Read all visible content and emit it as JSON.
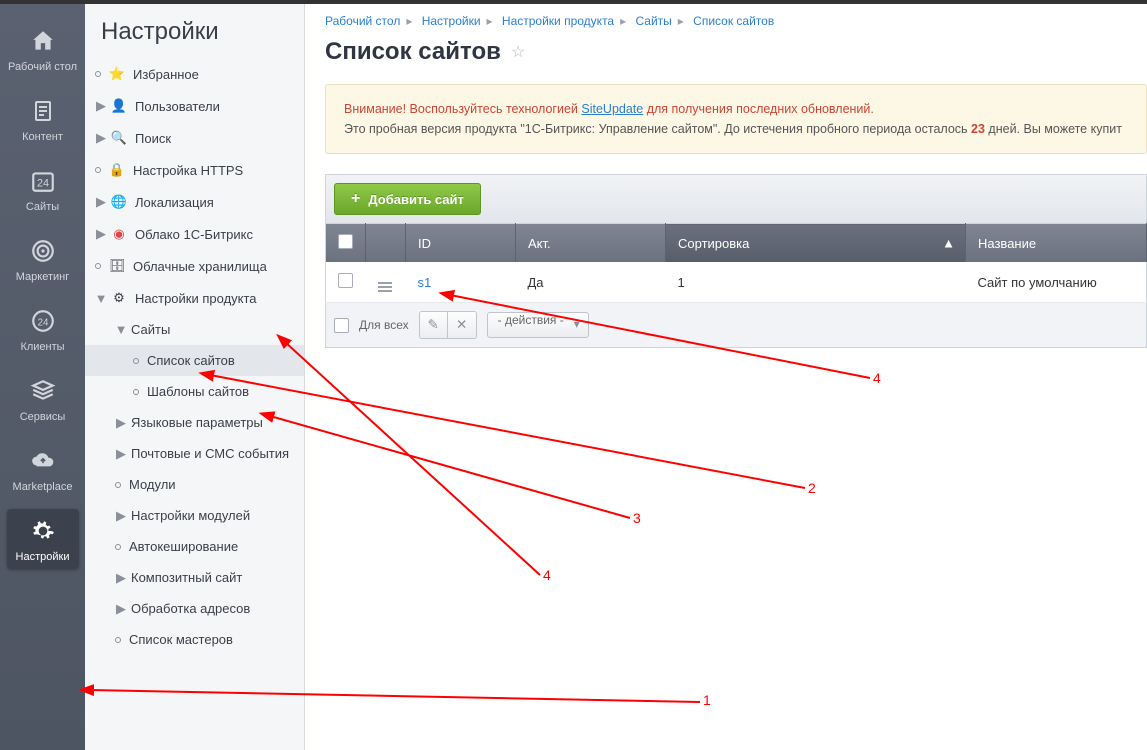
{
  "rail": [
    {
      "key": "desktop",
      "label": "Рабочий стол"
    },
    {
      "key": "content",
      "label": "Контент"
    },
    {
      "key": "sites",
      "label": "Сайты"
    },
    {
      "key": "marketing",
      "label": "Маркетинг"
    },
    {
      "key": "clients",
      "label": "Клиенты"
    },
    {
      "key": "services",
      "label": "Сервисы"
    },
    {
      "key": "marketplace",
      "label": "Marketplace"
    },
    {
      "key": "settings",
      "label": "Настройки"
    }
  ],
  "sidebar": {
    "title": "Настройки",
    "items": {
      "fav": "Избранное",
      "users": "Пользователи",
      "search": "Поиск",
      "https": "Настройка HTTPS",
      "local": "Локализация",
      "cloud1c": "Облако 1С-Битрикс",
      "cloudstor": "Облачные хранилища",
      "product": "Настройки продукта",
      "sites": "Сайты",
      "sitelist": "Список сайтов",
      "sitetpl": "Шаблоны сайтов",
      "langparam": "Языковые параметры",
      "mailsms": "Почтовые и СМС события",
      "modules": "Модули",
      "modset": "Настройки модулей",
      "autocache": "Автокеширование",
      "composite": "Композитный сайт",
      "urlproc": "Обработка адресов",
      "wizards": "Список мастеров"
    }
  },
  "breadcrumb": [
    "Рабочий стол",
    "Настройки",
    "Настройки продукта",
    "Сайты",
    "Список сайтов"
  ],
  "page_title": "Список сайтов",
  "alert": {
    "prefix": "Внимание! Воспользуйтесь технологией ",
    "link": "SiteUpdate",
    "suffix": " для получения последних обновлений.",
    "line2a": "Это пробная версия продукта \"1С-Битрикс: Управление сайтом\". До истечения пробного периода осталось ",
    "days": "23",
    "line2b": " дней. Вы можете купит"
  },
  "add_btn": "Добавить сайт",
  "table": {
    "headers": {
      "id": "ID",
      "act": "Акт.",
      "sort": "Сортировка",
      "name": "Название"
    },
    "row": {
      "id": "s1",
      "act": "Да",
      "sort": "1",
      "name": "Сайт по умолчанию"
    }
  },
  "footer": {
    "all": "Для всех",
    "actions": "- действия -"
  },
  "annotation_labels": {
    "n1": "1",
    "n2": "2",
    "n3": "3",
    "n4a": "4",
    "n4b": "4"
  }
}
